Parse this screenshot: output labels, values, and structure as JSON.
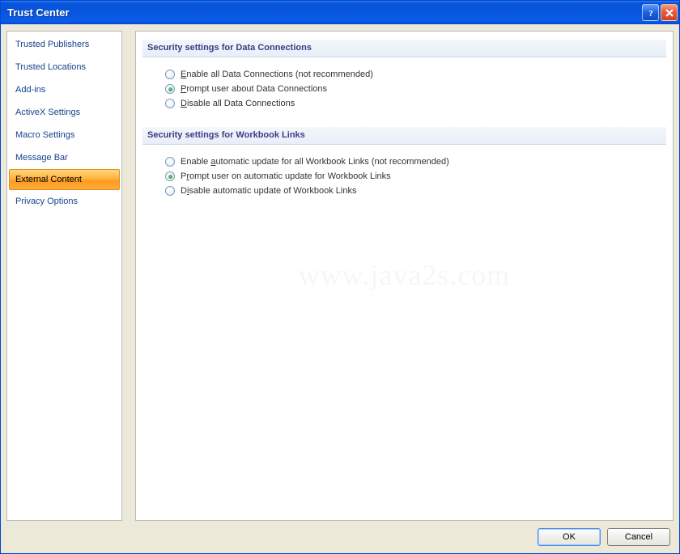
{
  "window": {
    "title": "Trust Center"
  },
  "nav": {
    "items": [
      {
        "label": "Trusted Publishers",
        "selected": false
      },
      {
        "label": "Trusted Locations",
        "selected": false
      },
      {
        "label": "Add-ins",
        "selected": false
      },
      {
        "label": "ActiveX Settings",
        "selected": false
      },
      {
        "label": "Macro Settings",
        "selected": false
      },
      {
        "label": "Message Bar",
        "selected": false
      },
      {
        "label": "External Content",
        "selected": true
      },
      {
        "label": "Privacy Options",
        "selected": false
      }
    ]
  },
  "content": {
    "section1": {
      "title": "Security settings for Data Connections",
      "options": [
        {
          "label_pre": "",
          "label_u": "E",
          "label_post": "nable all Data Connections (not recommended)",
          "checked": false
        },
        {
          "label_pre": "",
          "label_u": "P",
          "label_post": "rompt user about Data Connections",
          "checked": true
        },
        {
          "label_pre": "",
          "label_u": "D",
          "label_post": "isable all Data Connections",
          "checked": false
        }
      ]
    },
    "section2": {
      "title": "Security settings for Workbook Links",
      "options": [
        {
          "label_pre": "Enable ",
          "label_u": "a",
          "label_post": "utomatic update for all Workbook Links (not recommended)",
          "checked": false
        },
        {
          "label_pre": "P",
          "label_u": "r",
          "label_post": "ompt user on automatic update for Workbook Links",
          "checked": true
        },
        {
          "label_pre": "D",
          "label_u": "i",
          "label_post": "sable automatic update of Workbook Links",
          "checked": false
        }
      ]
    }
  },
  "buttons": {
    "ok": "OK",
    "cancel": "Cancel"
  },
  "watermark": "www.java2s.com"
}
